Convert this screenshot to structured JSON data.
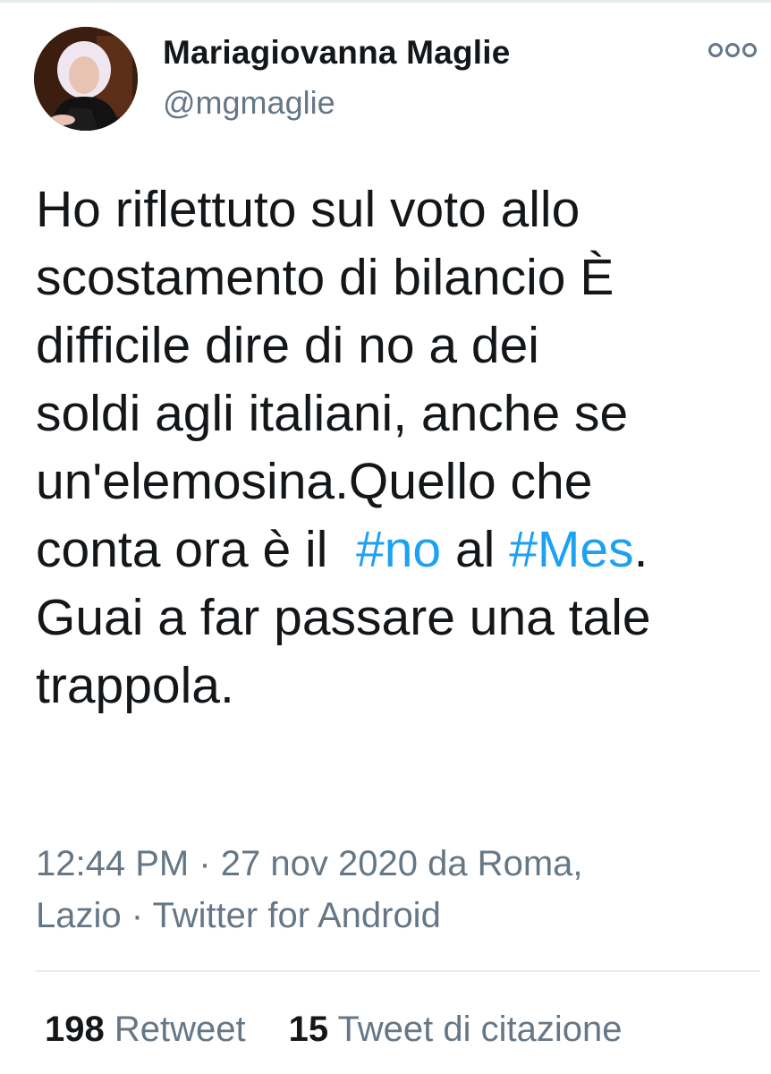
{
  "author": {
    "name": "Mariagiovanna Maglie",
    "handle": "@mgmaglie"
  },
  "tweet": {
    "text_1": "Ho riflettuto sul voto allo\nscostamento di bilancio È\ndifficile dire di no a dei\nsoldi agli italiani, anche se\nun'elemosina.Quello che\nconta ora è il  ",
    "hashtag_1": "#no",
    "text_2": " al ",
    "hashtag_2": "#Mes",
    "text_3": ".\nGuai a far passare una tale\ntrappola."
  },
  "meta": {
    "time": "12:44 PM",
    "sep_1": " · ",
    "date_location": "27 nov 2020 da Roma,\nLazio",
    "sep_2": " · ",
    "source": "Twitter for Android"
  },
  "stats": {
    "retweets_count": "198",
    "retweets_label": "Retweet",
    "quotes_count": "15",
    "quotes_label": "Tweet di citazione"
  },
  "icons": {
    "more": "more-options-icon"
  },
  "colors": {
    "link": "#1da1f2",
    "secondary_text": "#657786",
    "primary_text": "#14171a",
    "divider": "#e6ecf0"
  }
}
